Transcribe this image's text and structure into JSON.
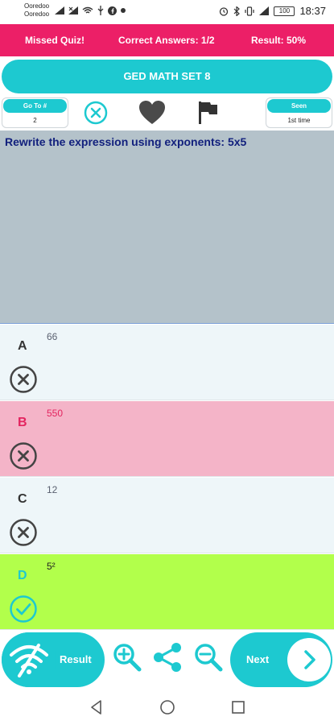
{
  "status_bar": {
    "carrier_1": "Ooredoo",
    "carrier_2": "Ooredoo",
    "battery": "100",
    "time": "18:37"
  },
  "header": {
    "left": "Missed Quiz!",
    "center": "Correct Answers: 1/2",
    "right": "Result: 50%"
  },
  "title": "GED MATH SET 8",
  "toolbar": {
    "goto_label": "Go To #",
    "goto_value": "2",
    "seen_label": "Seen",
    "seen_value": "1st time",
    "icons": [
      "close-circle-icon",
      "heart-icon",
      "flag-icon"
    ]
  },
  "question": "Rewrite the expression using exponents: 5x5",
  "answers": [
    {
      "letter": "A",
      "text": "66",
      "state": "wrong"
    },
    {
      "letter": "B",
      "text": "550",
      "state": "wrong-selected"
    },
    {
      "letter": "C",
      "text": "12",
      "state": "wrong"
    },
    {
      "letter": "D",
      "text": "5²",
      "state": "correct"
    }
  ],
  "bottom_bar": {
    "result_label": "Result",
    "next_label": "Next",
    "icons": [
      "zoom-in-icon",
      "share-icon",
      "zoom-out-icon",
      "chevron-right-icon"
    ]
  },
  "colors": {
    "accent": "#1dc9d0",
    "header": "#ec1f67",
    "question_bg": "#b4c2ca",
    "wrong_bg": "#f4b4c8",
    "correct_bg": "#b2ff4b"
  }
}
